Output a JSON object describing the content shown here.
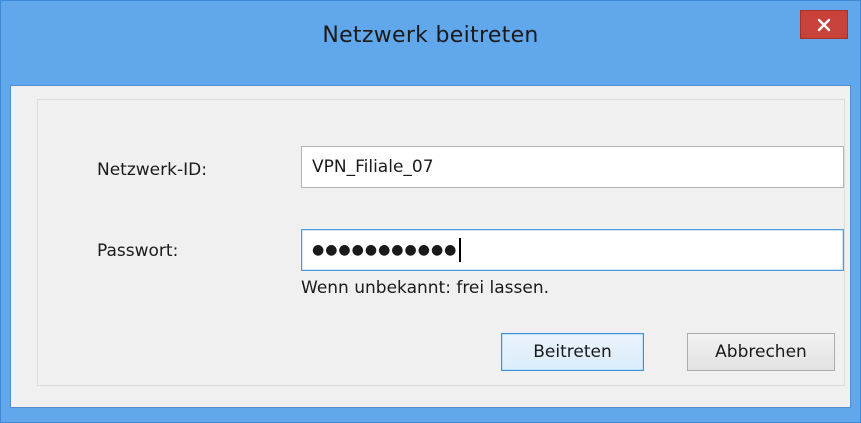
{
  "window": {
    "title": "Netzwerk beitreten",
    "close_label": "close",
    "titlebar_color": "#61a7ec",
    "close_color": "#c8423a"
  },
  "form": {
    "network_id_label": "Netzwerk-ID:",
    "network_id_value": "VPN_Filiale_07",
    "password_label": "Passwort:",
    "password_mask": "●●●●●●●●●●●",
    "hint": "Wenn unbekannt: frei lassen."
  },
  "buttons": {
    "join": "Beitreten",
    "cancel": "Abbrechen"
  },
  "icons": {
    "close": "close-icon"
  }
}
